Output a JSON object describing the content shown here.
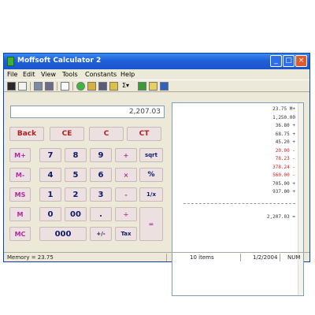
{
  "window": {
    "title": "Moffsoft Calculator 2",
    "controls": [
      "_",
      "□",
      "×"
    ]
  },
  "menu": [
    "File",
    "Edit",
    "View",
    "Tools",
    "Constants",
    "Help"
  ],
  "toolbar": {
    "icons": [
      "save-icon",
      "print-icon",
      "copy-icon",
      "paste-icon",
      "tape-icon",
      "green-dot-icon",
      "columns-icon",
      "calc-icon",
      "folder-icon",
      "function-icon",
      "plant-icon",
      "note-icon",
      "help-icon"
    ],
    "dropdown_label": "Σ▾"
  },
  "display": {
    "value": "2,207.03"
  },
  "keys": {
    "back": "Back",
    "ce": "CE",
    "c": "C",
    "ct": "CT",
    "mplus": "M+",
    "mminus": "M-",
    "mstore": "MS",
    "mrecall": "M",
    "mclear": "MC",
    "d7": "7",
    "d8": "8",
    "d9": "9",
    "d4": "4",
    "d5": "5",
    "d6": "6",
    "d1": "1",
    "d2": "2",
    "d3": "3",
    "d0": "0",
    "d00": "00",
    "d000": "000",
    "dot": ".",
    "plus_top": "+",
    "mult": "×",
    "minus": "-",
    "div": "÷",
    "sqrt": "sqrt",
    "pct": "%",
    "inv": "1/x",
    "sign": "+/-",
    "tax": "Tax",
    "equals": "="
  },
  "tape": {
    "lines": [
      {
        "text": "23.75 M+",
        "color": "#333"
      },
      {
        "text": "1,250.00",
        "color": "#333"
      },
      {
        "text": "36.80 +",
        "color": "#333"
      },
      {
        "text": "68.75 +",
        "color": "#333"
      },
      {
        "text": "45.20 +",
        "color": "#333"
      },
      {
        "text": "20.00 -",
        "color": "#d02020"
      },
      {
        "text": "78.23 -",
        "color": "#d02020"
      },
      {
        "text": "378.24 -",
        "color": "#d02020"
      },
      {
        "text": "560.00 -",
        "color": "#d02020"
      },
      {
        "text": "705.00 +",
        "color": "#333"
      },
      {
        "text": "937.00 +",
        "color": "#333"
      }
    ],
    "total": "2,207.03 ="
  },
  "status": {
    "memory": "Memory = 23.75",
    "items": "10 items",
    "date": "1/2/2004",
    "mode": "NUM"
  }
}
